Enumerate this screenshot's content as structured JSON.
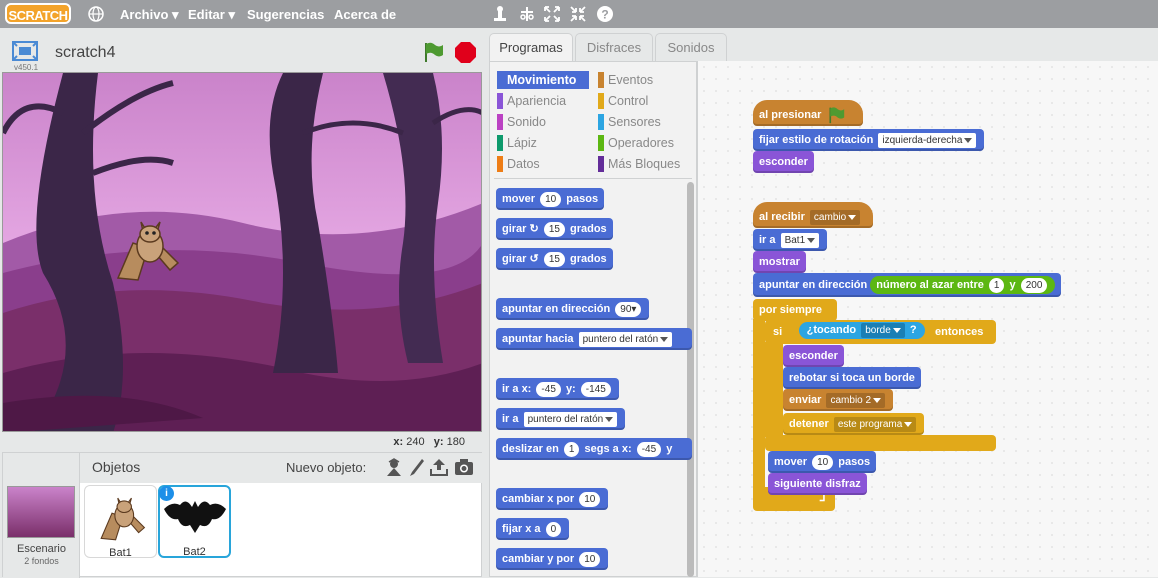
{
  "menubar": {
    "logo": "SCRATCH",
    "items": [
      "Archivo",
      "Editar",
      "Sugerencias",
      "Acerca de"
    ]
  },
  "stage": {
    "title": "scratch4",
    "version": "v450.1",
    "coord_x_label": "x:",
    "coord_x": "240",
    "coord_y_label": "y:",
    "coord_y": "180"
  },
  "sprites": {
    "header": "Objetos",
    "new_sprite": "Nuevo objeto:",
    "stage_label": "Escenario",
    "stage_backdrops": "2 fondos",
    "items": [
      "Bat1",
      "Bat2"
    ],
    "selected": "Bat2"
  },
  "tabs": [
    "Programas",
    "Disfraces",
    "Sonidos"
  ],
  "categories": {
    "left": [
      "Movimiento",
      "Apariencia",
      "Sonido",
      "Lápiz",
      "Datos"
    ],
    "right": [
      "Eventos",
      "Control",
      "Sensores",
      "Operadores",
      "Más Bloques"
    ],
    "colors": {
      "Movimiento": "#4a6cd4",
      "Apariencia": "#8a55d7",
      "Sonido": "#bb42c3",
      "Lápiz": "#0e9a6c",
      "Datos": "#ee7d16",
      "Eventos": "#c88330",
      "Control": "#e1a91a",
      "Sensores": "#2ca5e2",
      "Operadores": "#5cb712",
      "Más Bloques": "#632d99"
    }
  },
  "palette": {
    "mover": "mover",
    "mover_val": "10",
    "pasos": "pasos",
    "girar": "girar",
    "girar_val1": "15",
    "girar_val2": "15",
    "grados": "grados",
    "apuntar_dir": "apuntar en dirección",
    "apuntar_dir_val": "90",
    "apuntar_hacia": "apuntar hacia",
    "apuntar_hacia_val": "puntero del ratón",
    "ir_a_x": "ir a x:",
    "ir_x_val": "-45",
    "y_label": "y:",
    "ir_y_val": "-145",
    "ir_a": "ir a",
    "ir_a_val": "puntero del ratón",
    "deslizar": "deslizar en",
    "deslizar_val": "1",
    "segs_a_x": "segs a x:",
    "deslizar_x": "-45",
    "deslizar_y": "y",
    "cambiar_x": "cambiar x por",
    "cambiar_x_val": "10",
    "fijar_x": "fijar x a",
    "fijar_x_val": "0",
    "cambiar_y": "cambiar y por",
    "cambiar_y_val": "10"
  },
  "script1": {
    "hat": "al presionar",
    "rot": "fijar estilo de rotación",
    "rot_val": "izquierda-derecha",
    "hide": "esconder"
  },
  "script2": {
    "hat": "al recibir",
    "hat_val": "cambio",
    "goto": "ir a",
    "goto_val": "Bat1",
    "show": "mostrar",
    "point": "apuntar en dirección",
    "random": "número al azar entre",
    "rand_from": "1",
    "rand_and": "y",
    "rand_to": "200",
    "forever": "por siempre",
    "if": "si",
    "touching": "¿tocando",
    "touching_val": "borde",
    "touching_q": "?",
    "then": "entonces",
    "hide": "esconder",
    "bounce": "rebotar si toca un borde",
    "broadcast": "enviar",
    "broadcast_val": "cambio 2",
    "stop": "detener",
    "stop_val": "este programa",
    "move": "mover",
    "move_val": "10",
    "steps": "pasos",
    "next": "siguiente disfraz"
  }
}
